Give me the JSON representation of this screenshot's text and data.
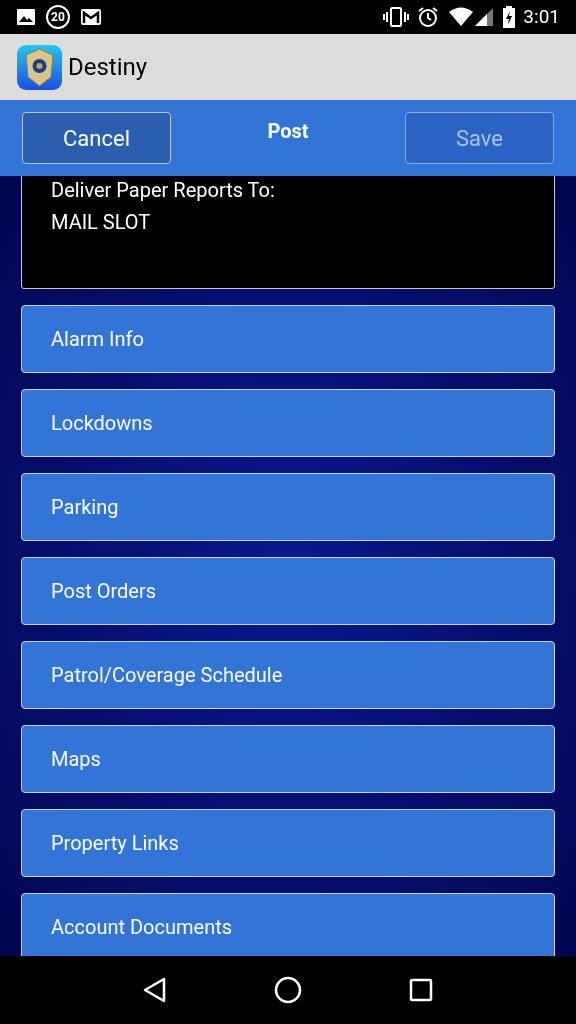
{
  "status_bar": {
    "notification_count": "20",
    "time": "3:01"
  },
  "app_bar": {
    "title": "Destiny"
  },
  "toolbar": {
    "title": "Post",
    "buttons": [
      {
        "label": "Cancel",
        "disabled": false
      },
      {
        "label": "Save",
        "disabled": true
      }
    ]
  },
  "info_card": {
    "lines": [
      "Deliver Paper Reports To:",
      "MAIL SLOT"
    ]
  },
  "menu_items": [
    {
      "label": "Alarm Info"
    },
    {
      "label": "Lockdowns"
    },
    {
      "label": "Parking"
    },
    {
      "label": "Post Orders"
    },
    {
      "label": "Patrol/Coverage Schedule"
    },
    {
      "label": "Maps"
    },
    {
      "label": "Property Links"
    },
    {
      "label": "Account Documents"
    }
  ]
}
